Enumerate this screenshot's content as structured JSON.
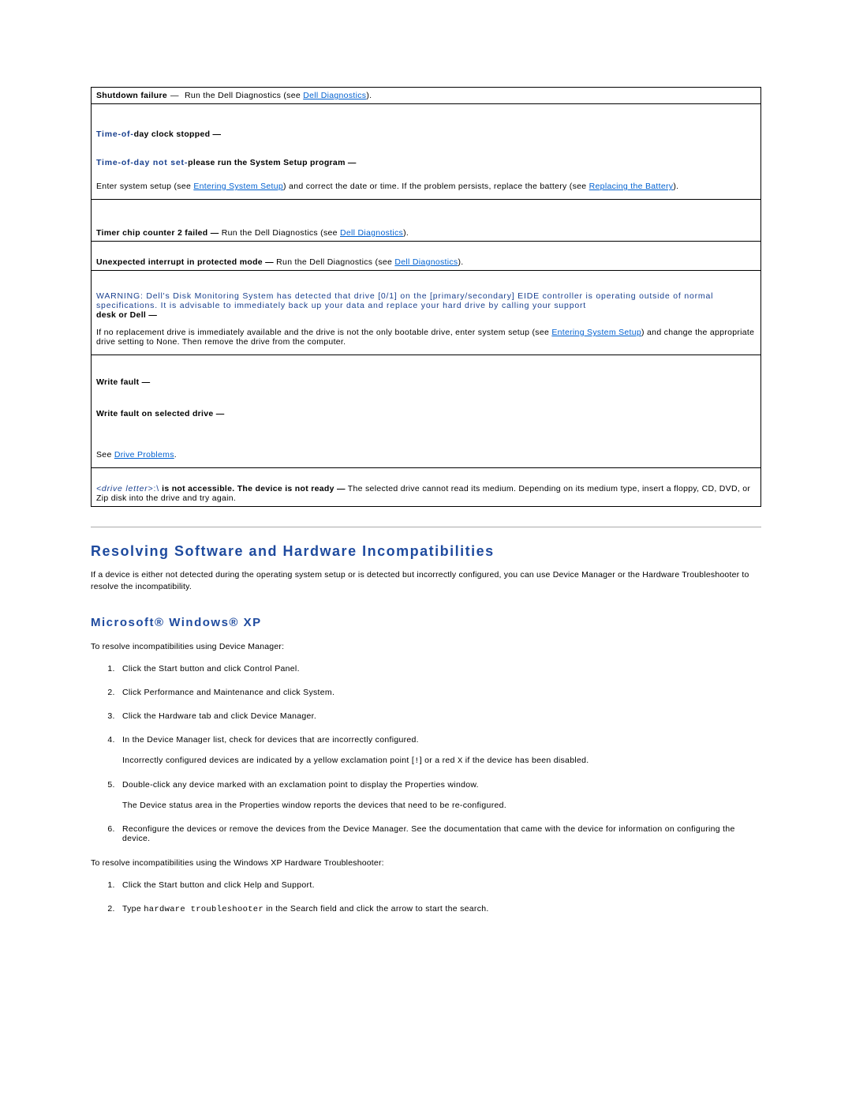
{
  "rows": {
    "shutdown": {
      "label": "Shutdown failure",
      "text": "Run the Dell Diagnostics (see ",
      "link": "Dell Diagnostics",
      "tail": ")."
    },
    "tod_stopped": "Time-of-day clock stopped  —",
    "tod_notset_prefix": "Time-of-day not set-",
    "tod_notset_bold": "please run the System Setup program  —",
    "enter_setup_1": "Enter system setup (see ",
    "enter_setup_link1": "Entering System Setup",
    "enter_setup_2": ") and correct the date or time. If the problem persists, replace the battery (see ",
    "enter_setup_link2": "Replacing the Battery",
    "enter_setup_3": ").",
    "timer_chip": {
      "label": "Timer chip counter 2 failed  —",
      "text": "Run the Dell Diagnostics (see ",
      "link": "Dell Diagnostics",
      "tail": ")."
    },
    "unexpected": {
      "label": "Unexpected interrupt in protected mode  —",
      "text": "Run the Dell Diagnostics (see ",
      "link": "Dell Diagnostics",
      "tail": ")."
    },
    "warning_1": "WARNING: Dell's Disk Monitoring System has detected that drive [0/1] on the [primary/secondary] EIDE controller is operating outside of normal specifications. It is advisable to immediately back up your data and replace your hard drive by calling your support ",
    "warning_bold": "desk or Dell  —",
    "warning_2a": " If no replacement drive is immediately available and the drive is not the only bootable drive, enter system setup (see ",
    "warning_link": "Entering System Setup",
    "warning_2b": ") and change the appropriate drive setting to None. Then remove the drive from the computer.",
    "write_fault": "Write fault  —",
    "write_fault_sel": "Write fault on selected drive  —",
    "see": "See ",
    "drive_problems": "Drive Problems",
    "dot": ".",
    "drive_letter_prefix": "<drive letter>:\\",
    "drive_letter_bold": " is not accessible. The device is not ready  —",
    "drive_letter_text": "The selected drive cannot read its medium. Depending on its medium type, insert a floppy, CD, DVD, or Zip disk into the drive and try again."
  },
  "section": {
    "heading": "Resolving Software and Hardware Incompatibilities",
    "intro": "If a device is either not detected during the operating system setup or is detected but incorrectly configured, you can use Device Manager or the Hardware Troubleshooter to resolve the incompatibility.",
    "sub": "Microsoft® Windows® XP",
    "dm_intro": "To resolve incompatibilities using Device Manager:",
    "dm_steps": [
      "Click the Start button and click Control Panel.",
      "Click Performance and Maintenance and click System.",
      "Click the Hardware tab and click Device Manager.",
      "In the Device Manager list, check for devices that are incorrectly configured.",
      "Double-click any device marked with an exclamation point to display the Properties window.",
      "Reconfigure the devices or remove the devices from the Device Manager. See the documentation that came with the device for information on configuring the device."
    ],
    "dm_step4_sub_a": "Incorrectly configured devices are indicated by a yellow exclamation point [",
    "dm_step4_sub_mono": "!",
    "dm_step4_sub_b": "] or a red ",
    "dm_step4_sub_x": "X",
    "dm_step4_sub_c": " if the device has been disabled.",
    "dm_step5_sub": "The Device status area in the Properties window reports the devices that need to be re-configured.",
    "ht_intro": "To resolve incompatibilities using the Windows XP Hardware Troubleshooter:",
    "ht_steps": [
      "Click the Start button and click Help and Support.",
      ""
    ],
    "ht_step2_a": "Type ",
    "ht_step2_mono": "hardware troubleshooter",
    "ht_step2_b": " in the Search field and click the arrow to start the search."
  }
}
